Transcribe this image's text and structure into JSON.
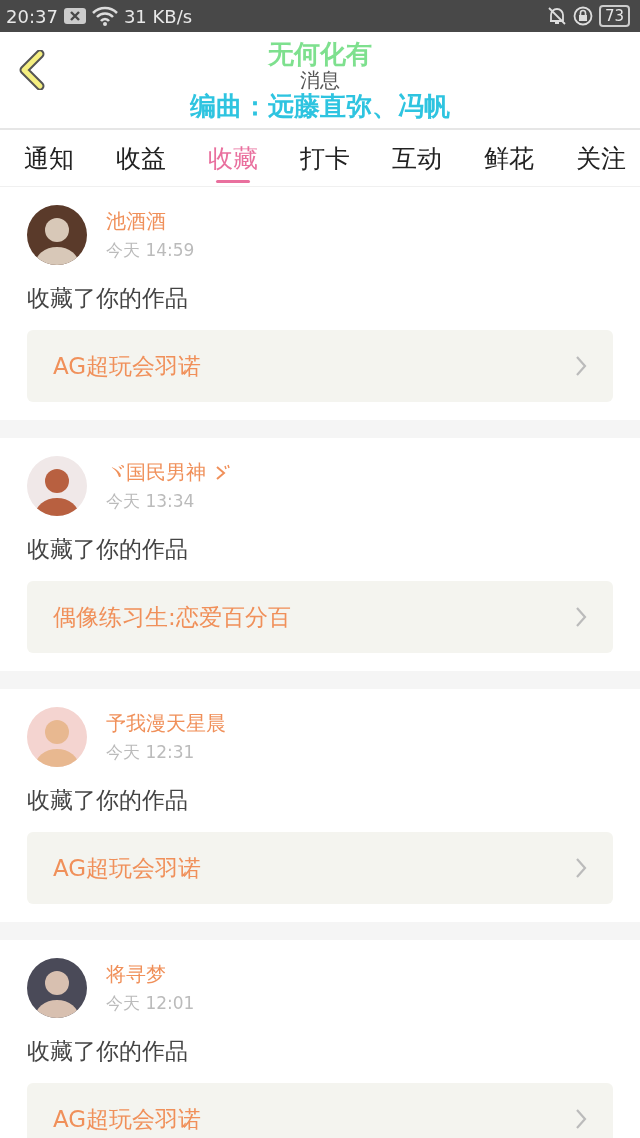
{
  "status_bar": {
    "time": "20:37",
    "speed": "31 KB/s",
    "battery": "73"
  },
  "header": {
    "title": "消息"
  },
  "lyrics_overlay": [
    "无何化有",
    "编曲：远藤直弥、冯帆"
  ],
  "tabs": [
    {
      "label": "通知",
      "selected": false
    },
    {
      "label": "收益",
      "selected": false
    },
    {
      "label": "收藏",
      "selected": true
    },
    {
      "label": "打卡",
      "selected": false
    },
    {
      "label": "互动",
      "selected": false
    },
    {
      "label": "鲜花",
      "selected": false
    },
    {
      "label": "关注",
      "selected": false
    }
  ],
  "messages": [
    {
      "user": "池酒酒",
      "time": "今天 14:59",
      "action": "收藏了你的作品",
      "work": "AG超玩会羽诺"
    },
    {
      "user": "ヾ国民男神",
      "name_mark": true,
      "time": "今天 13:34",
      "action": "收藏了你的作品",
      "work": "偶像练习生:恋爱百分百"
    },
    {
      "user": "予我漫天星晨",
      "time": "今天 12:31",
      "action": "收藏了你的作品",
      "work": "AG超玩会羽诺"
    },
    {
      "user": "将寻梦",
      "time": "今天 12:01",
      "action": "收藏了你的作品",
      "work": "AG超玩会羽诺"
    }
  ]
}
